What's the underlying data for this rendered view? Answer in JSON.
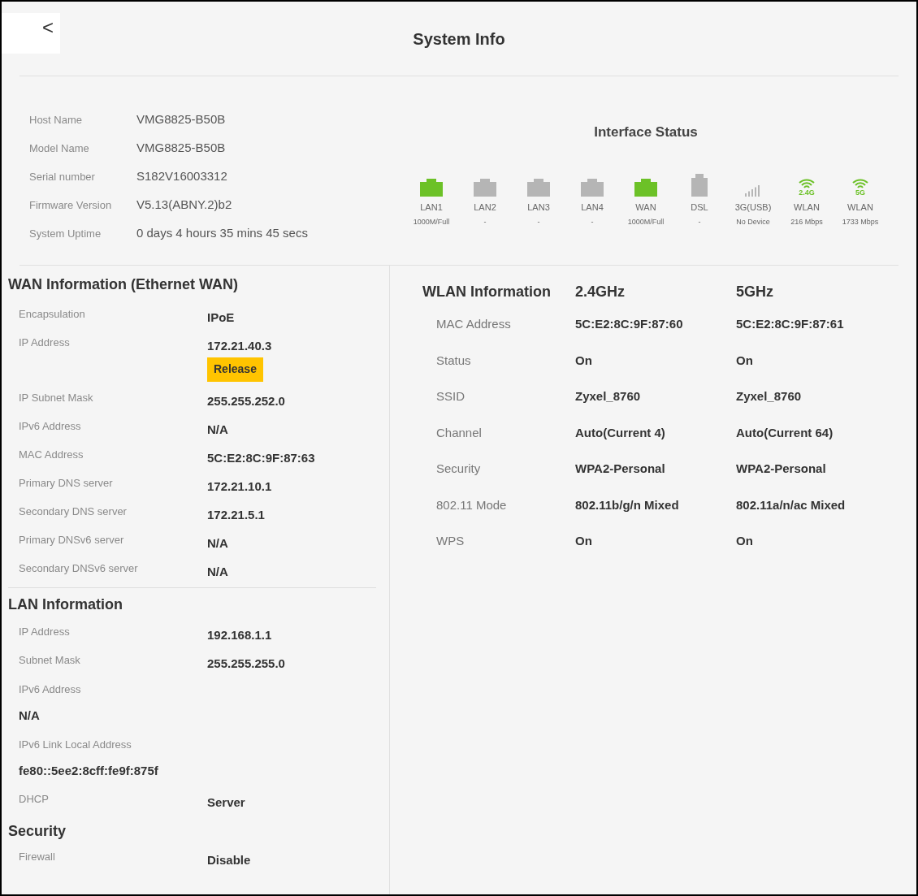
{
  "header": {
    "back": "<",
    "title": "System Info"
  },
  "system_info": [
    {
      "label": "Host Name",
      "value": "VMG8825-B50B"
    },
    {
      "label": "Model Name",
      "value": "VMG8825-B50B"
    },
    {
      "label": "Serial number",
      "value": "S182V16003312"
    },
    {
      "label": "Firmware Version",
      "value": "V5.13(ABNY.2)b2"
    },
    {
      "label": "System Uptime",
      "value": "0 days 4 hours 35 mins 45 secs"
    }
  ],
  "interface_status": {
    "title": "Interface Status",
    "interfaces": [
      {
        "kind": "ethernet",
        "connected": true,
        "name": "LAN1",
        "status": "1000M/Full"
      },
      {
        "kind": "ethernet",
        "connected": false,
        "name": "LAN2",
        "status": "-"
      },
      {
        "kind": "ethernet",
        "connected": false,
        "name": "LAN3",
        "status": "-"
      },
      {
        "kind": "ethernet",
        "connected": false,
        "name": "LAN4",
        "status": "-"
      },
      {
        "kind": "ethernet",
        "connected": true,
        "name": "WAN",
        "status": "1000M/Full"
      },
      {
        "kind": "dsl",
        "connected": false,
        "name": "DSL",
        "status": "-"
      },
      {
        "kind": "cellular",
        "connected": false,
        "name": "3G(USB)",
        "status": "No Device"
      },
      {
        "kind": "wifi",
        "connected": true,
        "band": "2.4G",
        "name": "WLAN",
        "status": "216 Mbps"
      },
      {
        "kind": "wifi",
        "connected": true,
        "band": "5G",
        "name": "WLAN",
        "status": "1733 Mbps"
      }
    ]
  },
  "wan_information": {
    "title": "WAN Information (Ethernet WAN)",
    "rows": [
      {
        "kind": "inline",
        "label": "Encapsulation",
        "value": "IPoE"
      },
      {
        "kind": "inline",
        "label": "IP Address",
        "value": "172.21.40.3",
        "button": "Release"
      },
      {
        "kind": "inline",
        "label": "IP Subnet Mask",
        "value": "255.255.252.0"
      },
      {
        "kind": "inline",
        "label": "IPv6 Address",
        "value": "N/A"
      },
      {
        "kind": "inline",
        "label": "MAC Address",
        "value": "5C:E2:8C:9F:87:63"
      },
      {
        "kind": "inline",
        "label": "Primary DNS server",
        "value": "172.21.10.1"
      },
      {
        "kind": "inline",
        "label": "Secondary DNS server",
        "value": "172.21.5.1"
      },
      {
        "kind": "inline",
        "label": "Primary DNSv6 server",
        "value": "N/A"
      },
      {
        "kind": "inline",
        "label": "Secondary DNSv6 server",
        "value": "N/A"
      }
    ]
  },
  "lan_information": {
    "title": "LAN Information",
    "rows": [
      {
        "kind": "inline",
        "label": "IP Address",
        "value": "192.168.1.1"
      },
      {
        "kind": "inline",
        "label": "Subnet Mask",
        "value": "255.255.255.0"
      },
      {
        "kind": "stacked",
        "label": "IPv6 Address",
        "value": "N/A"
      },
      {
        "kind": "stacked",
        "label": "IPv6 Link Local Address",
        "value": "fe80::5ee2:8cff:fe9f:875f"
      },
      {
        "kind": "inline",
        "label": "DHCP",
        "value": "Server"
      }
    ]
  },
  "security": {
    "title": "Security",
    "rows": [
      {
        "kind": "inline",
        "label": "Firewall",
        "value": "Disable"
      }
    ]
  },
  "wlan_information": {
    "title": "WLAN Information",
    "columns": [
      "2.4GHz",
      "5GHz"
    ],
    "rows": [
      {
        "label": "MAC Address",
        "values": [
          "5C:E2:8C:9F:87:60",
          "5C:E2:8C:9F:87:61"
        ]
      },
      {
        "label": "Status",
        "values": [
          "On",
          "On"
        ]
      },
      {
        "label": "SSID",
        "values": [
          "Zyxel_8760",
          "Zyxel_8760"
        ]
      },
      {
        "label": "Channel",
        "values": [
          "Auto(Current 4)",
          "Auto(Current 64)"
        ]
      },
      {
        "label": "Security",
        "values": [
          "WPA2-Personal",
          "WPA2-Personal"
        ]
      },
      {
        "label": "802.11 Mode",
        "values": [
          "802.11b/g/n Mixed",
          "802.11a/n/ac Mixed"
        ]
      },
      {
        "label": "WPS",
        "values": [
          "On",
          "On"
        ]
      }
    ]
  }
}
